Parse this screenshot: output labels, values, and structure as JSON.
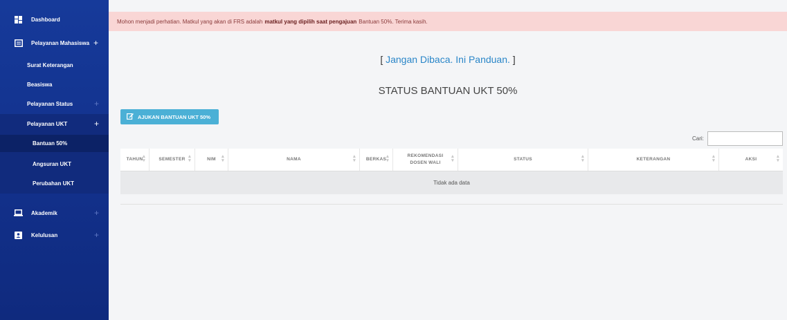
{
  "sidebar": {
    "dashboard": "Dashboard",
    "pelayanan_mahasiswa": "Pelayanan Mahasiswa",
    "surat_keterangan": "Surat Keterangan",
    "beasiswa": "Beasiswa",
    "pelayanan_status": "Pelayanan Status",
    "pelayanan_ukt": "Pelayanan UKT",
    "bantuan_50": "Bantuan 50%",
    "angsuran_ukt": "Angsuran UKT",
    "perubahan_ukt": "Perubahan UKT",
    "akademik": "Akademik",
    "kelulusan": "Kelulusan",
    "plus": "+"
  },
  "alert": {
    "part1": "Mohon menjadi perhatian. Matkul yang akan di FRS adalah ",
    "bold": "matkul yang dipilih saat pengajuan",
    "part2": " Bantuan 50%. Terima kasih."
  },
  "guide": {
    "open": "[ ",
    "link": "Jangan Dibaca. Ini Panduan.",
    "close": " ]"
  },
  "page_title": "STATUS BANTUAN UKT 50%",
  "apply_button": "AJUKAN BANTUAN UKT 50%",
  "search_label": "Cari:",
  "table": {
    "headers": [
      "TAHUN",
      "SEMESTER",
      "NIM",
      "NAMA",
      "BERKAS",
      "REKOMENDASI DOSEN WALI",
      "STATUS",
      "KETERANGAN",
      "AKSI"
    ],
    "empty_text": "Tidak ada data"
  },
  "colors": {
    "sidebar": "#163a9a",
    "alert_bg": "#f9d6d5",
    "button": "#4bb0d6",
    "link": "#2a86c8"
  },
  "icons": {
    "dashboard": "grid-icon",
    "pelayanan": "list-icon",
    "akademik": "laptop-icon",
    "kelulusan": "user-card-icon",
    "apply": "edit-icon"
  }
}
